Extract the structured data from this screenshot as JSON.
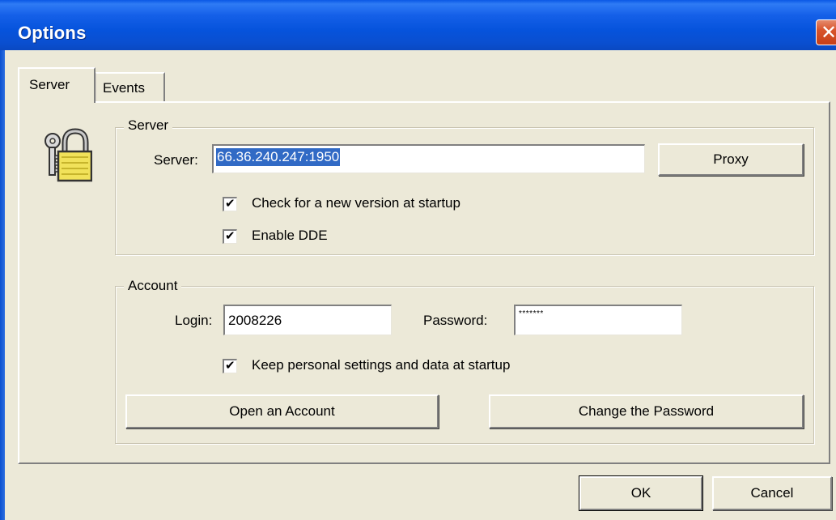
{
  "window": {
    "title": "Options",
    "close_label": "✕"
  },
  "tabs": [
    {
      "label": "Server",
      "selected": true
    },
    {
      "label": "Events",
      "selected": false
    }
  ],
  "icons": {
    "dialog_icon": "lock-keys-icon"
  },
  "server_group": {
    "legend": "Server",
    "server_label": "Server:",
    "server_value": "66.36.240.247:1950",
    "proxy_button": "Proxy",
    "check_version_label": "Check for a new version at startup",
    "check_version_checked": true,
    "enable_dde_label": "Enable DDE",
    "enable_dde_checked": true
  },
  "account_group": {
    "legend": "Account",
    "login_label": "Login:",
    "login_value": "2008226",
    "password_label": "Password:",
    "password_value": "*******",
    "keep_settings_label": "Keep personal settings and data at startup",
    "keep_settings_checked": true,
    "open_account_button": "Open an Account",
    "change_password_button": "Change the Password"
  },
  "footer": {
    "ok_button": "OK",
    "cancel_button": "Cancel"
  },
  "colors": {
    "titlebar": "#0653dc",
    "dialog_bg": "#ece9d8",
    "selection": "#316ac5",
    "close_button": "#d8542c"
  }
}
